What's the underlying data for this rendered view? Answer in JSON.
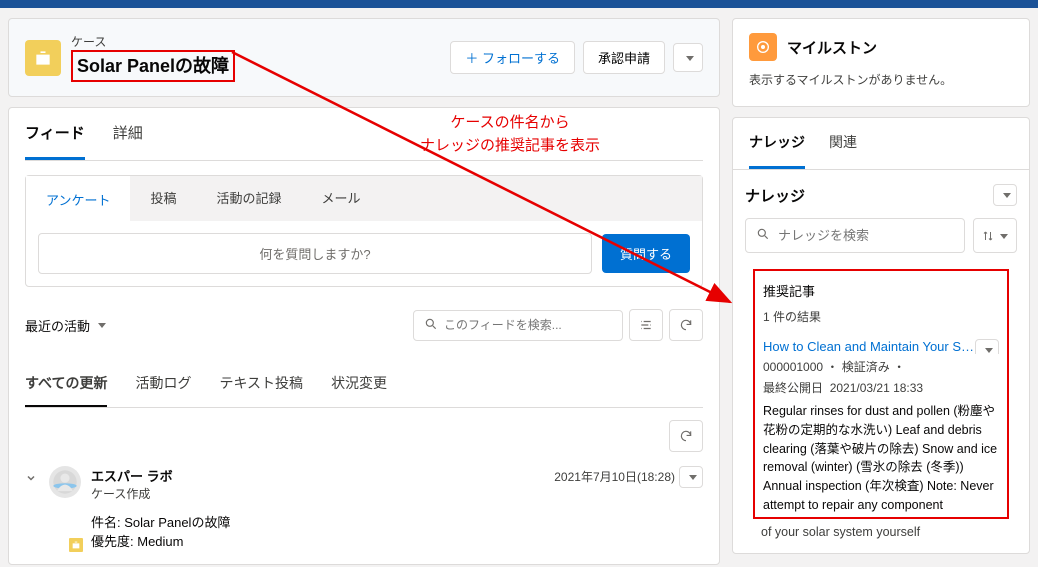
{
  "case_header": {
    "type_label": "ケース",
    "title": "Solar Panelの故障",
    "follow_label": "フォローする",
    "approve_label": "承認申請"
  },
  "main_tabs": {
    "feed": "フィード",
    "detail": "詳細"
  },
  "publisher_tabs": {
    "survey": "アンケート",
    "post": "投稿",
    "log": "活動の記録",
    "email": "メール"
  },
  "composer": {
    "placeholder": "何を質問しますか?",
    "ask_btn": "質問する"
  },
  "activity": {
    "recent_label": "最近の活動",
    "search_placeholder": "このフィードを検索..."
  },
  "update_tabs": {
    "all": "すべての更新",
    "log": "活動ログ",
    "textpost": "テキスト投稿",
    "status": "状況変更"
  },
  "feed_item": {
    "author": "エスパー ラボ",
    "event": "ケース作成",
    "date": "2021年7月10日(18:28)",
    "subject_label": "件名: ",
    "subject_value": "Solar Panelの故障",
    "priority_label": "優先度: ",
    "priority_value": "Medium"
  },
  "milestone": {
    "title": "マイルストン",
    "empty": "表示するマイルストンがありません。"
  },
  "knowledge": {
    "tab_knowledge": "ナレッジ",
    "tab_related": "関連",
    "panel_title": "ナレッジ",
    "search_placeholder": "ナレッジを検索",
    "suggest_title": "推奨記事",
    "result_count": "1 件の結果",
    "article": {
      "title": "How to Clean and Maintain Your Solar ...",
      "number": "000001000",
      "status": "検証済み",
      "published_label": "最終公開日",
      "published_date": "2021/03/21 18:33",
      "body": "Regular rinses for dust and pollen (粉塵や花粉の定期的な水洗い) Leaf and debris clearing (落葉や破片の除去) Snow and ice removal (winter) (雪氷の除去 (冬季)) Annual inspection (年次検査) Note: Never attempt to repair any component",
      "below": "of your solar system yourself"
    }
  },
  "annotation": {
    "line1": "ケースの件名から",
    "line2": "ナレッジの推奨記事を表示"
  }
}
